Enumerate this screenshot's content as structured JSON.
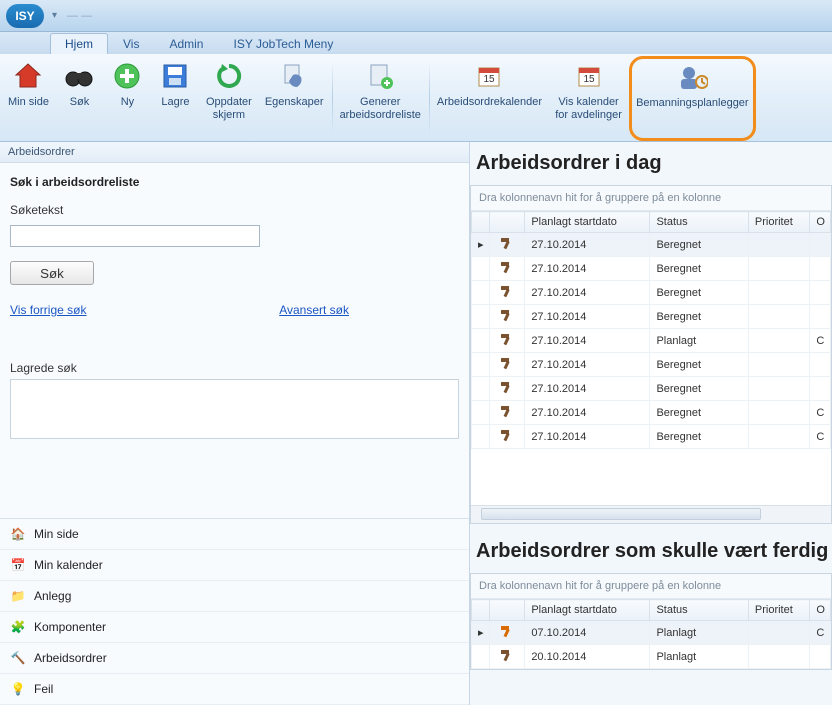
{
  "logo_text": "ISY",
  "tabs": {
    "hjem": "Hjem",
    "vis": "Vis",
    "admin": "Admin",
    "meny": "ISY JobTech Meny"
  },
  "ribbon": {
    "min_side": "Min side",
    "sok": "Søk",
    "ny": "Ny",
    "lagre": "Lagre",
    "oppdater": "Oppdater\nskjerm",
    "egenskaper": "Egenskaper",
    "generer": "Generer\narbeidsordreliste",
    "ao_kal": "Arbeidsordrekalender",
    "vis_kal": "Vis kalender\nfor avdelinger",
    "bemanning": "Bemanningsplanlegger"
  },
  "left": {
    "header": "Arbeidsordrer",
    "search_title": "Søk i arbeidsordreliste",
    "soketekst": "Søketekst",
    "sok_btn": "Søk",
    "vis_forrige": "Vis forrige søk",
    "avansert": "Avansert søk",
    "lagrede": "Lagrede søk",
    "nav": {
      "min_side": "Min side",
      "min_kalender": "Min kalender",
      "anlegg": "Anlegg",
      "komponenter": "Komponenter",
      "arbeidsordrer": "Arbeidsordrer",
      "feil": "Feil"
    }
  },
  "right": {
    "title1": "Arbeidsordrer i dag",
    "title2": "Arbeidsordrer som skulle vært ferdig",
    "group_hint": "Dra kolonnenavn hit for å gruppere på en kolonne",
    "cols": {
      "date": "Planlagt startdato",
      "status": "Status",
      "prio": "Prioritet",
      "o": "O"
    },
    "rows_today": [
      {
        "date": "27.10.2014",
        "status": "Beregnet",
        "o": ""
      },
      {
        "date": "27.10.2014",
        "status": "Beregnet",
        "o": ""
      },
      {
        "date": "27.10.2014",
        "status": "Beregnet",
        "o": ""
      },
      {
        "date": "27.10.2014",
        "status": "Beregnet",
        "o": ""
      },
      {
        "date": "27.10.2014",
        "status": "Planlagt",
        "o": "C"
      },
      {
        "date": "27.10.2014",
        "status": "Beregnet",
        "o": ""
      },
      {
        "date": "27.10.2014",
        "status": "Beregnet",
        "o": ""
      },
      {
        "date": "27.10.2014",
        "status": "Beregnet",
        "o": "C"
      },
      {
        "date": "27.10.2014",
        "status": "Beregnet",
        "o": "C"
      }
    ],
    "rows_overdue": [
      {
        "date": "07.10.2014",
        "status": "Planlagt",
        "o": "C",
        "orange": true
      },
      {
        "date": "20.10.2014",
        "status": "Planlagt",
        "o": ""
      }
    ]
  }
}
